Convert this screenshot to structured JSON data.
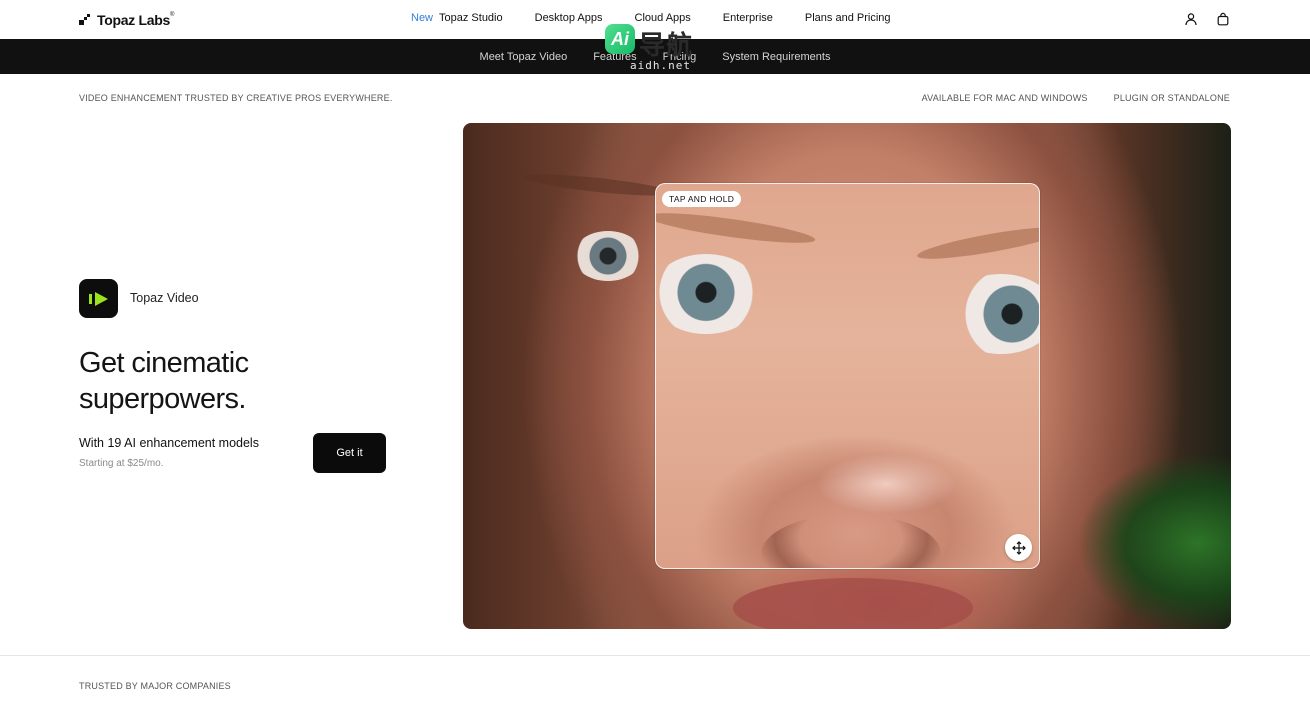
{
  "brand": {
    "name": "Topaz Labs",
    "mark": "®"
  },
  "nav": {
    "badge_new": "New",
    "links": [
      "Topaz Studio",
      "Desktop Apps",
      "Cloud Apps",
      "Enterprise",
      "Plans and Pricing"
    ],
    "icons": [
      "user-icon",
      "bag-icon"
    ]
  },
  "subnav": {
    "links": [
      "Meet Topaz Video",
      "Features",
      "Pricing",
      "System Requirements"
    ]
  },
  "watermark": {
    "badge": "Ai",
    "cn": "导航",
    "url": "aidh.net"
  },
  "meta": {
    "left": "VIDEO ENHANCEMENT TRUSTED BY CREATIVE PROS EVERYWHERE.",
    "right": [
      "AVAILABLE FOR MAC AND WINDOWS",
      "PLUGIN OR STANDALONE"
    ]
  },
  "hero": {
    "app_name": "Topaz Video",
    "headline_line1": "Get cinematic",
    "headline_line2": "superpowers.",
    "tagline": "With 19 AI enhancement models",
    "price": "Starting at $25/mo.",
    "cta_label": "Get it",
    "compare_pill": "TAP AND HOLD",
    "move_icon": "move-icon"
  },
  "footer": {
    "trusted": "TRUSTED BY MAJOR COMPANIES"
  },
  "colors": {
    "accent_new": "#2f7fd8",
    "subnav_bg": "#111111",
    "cta_bg": "#0b0b0b",
    "app_icon_green": "#9be21f"
  }
}
